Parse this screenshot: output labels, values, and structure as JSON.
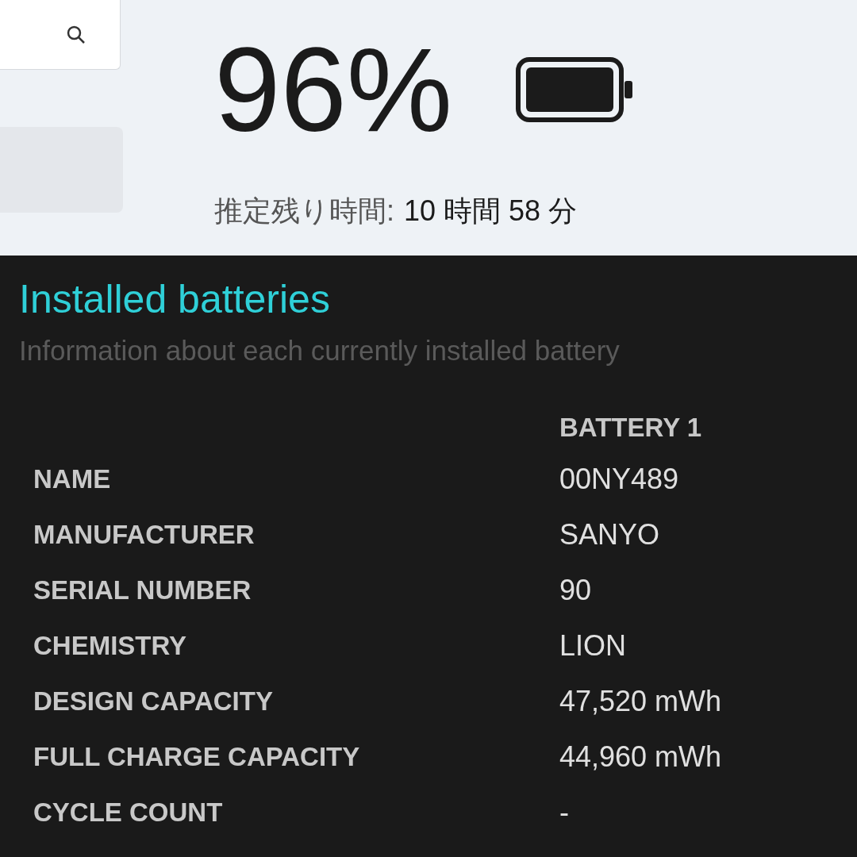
{
  "top": {
    "percent": "96%",
    "remaining_label": "推定残り時間:",
    "remaining_value": "10 時間 58 分"
  },
  "report": {
    "title": "Installed batteries",
    "subtitle": "Information about each currently installed battery",
    "column_header": "BATTERY 1",
    "rows": [
      {
        "label": "NAME",
        "value": "00NY489"
      },
      {
        "label": "MANUFACTURER",
        "value": "SANYO"
      },
      {
        "label": "SERIAL NUMBER",
        "value": "90"
      },
      {
        "label": "CHEMISTRY",
        "value": "LION"
      },
      {
        "label": "DESIGN CAPACITY",
        "value": "47,520 mWh"
      },
      {
        "label": "FULL CHARGE CAPACITY",
        "value": "44,960 mWh"
      },
      {
        "label": "CYCLE COUNT",
        "value": "-"
      }
    ]
  }
}
